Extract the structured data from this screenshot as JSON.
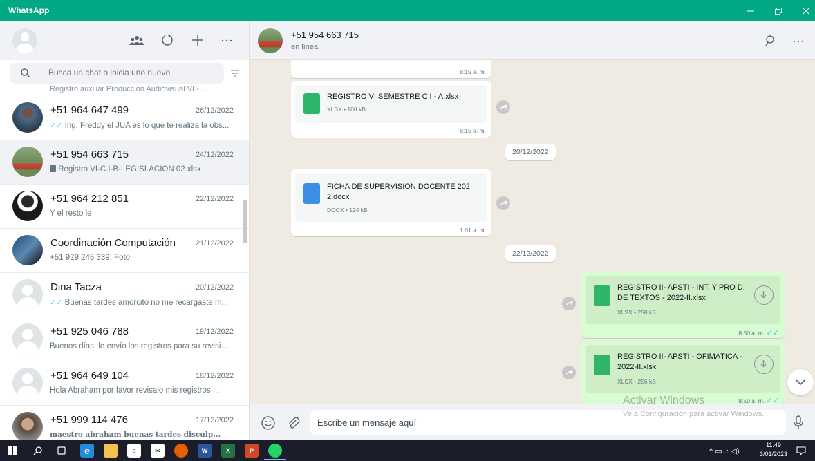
{
  "window": {
    "title": "WhatsApp"
  },
  "search": {
    "placeholder": "Busca un chat o inicia uno nuevo."
  },
  "chats": {
    "partial_top": "Registro auxiliar Producción Audiovisual VI - ...",
    "items": [
      {
        "name": "+51 964 647 499",
        "date": "26/12/2022",
        "preview": "Ing. Freddy el JUA es lo que te realiza la obs...",
        "ticks": "✓✓"
      },
      {
        "name": "+51 954 663 715",
        "date": "24/12/2022",
        "preview": "Registro VI-C.I-B-LEGISLACION 02.xlsx",
        "doc_icon": "document-icon"
      },
      {
        "name": "+51 964 212 851",
        "date": "22/12/2022",
        "preview": "Y el resto le"
      },
      {
        "name": "Coordinación Computación",
        "date": "21/12/2022",
        "preview": "+51 929 245 339:  Foto",
        "camera_icon": "camera-icon"
      },
      {
        "name": "Dina Tacza",
        "date": "20/12/2022",
        "preview": "Buenas tardes amorcito no me recargaste m...",
        "ticks": "✓✓"
      },
      {
        "name": "+51 925 046 788",
        "date": "19/12/2022",
        "preview": "Buenos días, le envío los registros para su revisi..."
      },
      {
        "name": "+51 964 649 104",
        "date": "18/12/2022",
        "preview": "Hola Abraham por favor revisalo mis registros ..."
      },
      {
        "name": "+51 999 114 476",
        "date": "17/12/2022",
        "preview": "maestro abraham buenas tardes disculp..."
      }
    ]
  },
  "conversation": {
    "contact_name": "+51 954 663 715",
    "status": "en línea",
    "first_time": "8:15 a. m.",
    "messages": [
      {
        "file": "REGISTRO VI SEMESTRE C I - A.xlsx",
        "meta": "XLSX • 108 kB",
        "time": "8:15 a. m."
      },
      {
        "file": "FICHA DE SUPERVISION DOCENTE 202 2.docx",
        "meta": "DOCX • 124 kB",
        "time": "1:01 a. m."
      },
      {
        "file": "REGISTRO II- APSTI - INT. Y PRO D. DE TEXTOS - 2022-II.xlsx",
        "meta": "XLSX • 258 kB",
        "time": "8:50 a. m."
      },
      {
        "file": "REGISTRO II- APSTI - OFIMÁTICA - 2022-II.xlsx",
        "meta": "XLSX • 256 kB",
        "time": "8:50 a. m."
      }
    ],
    "dates": [
      "20/12/2022",
      "22/12/2022"
    ]
  },
  "composer": {
    "placeholder": "Escribe un mensaje aquí"
  },
  "watermark": {
    "line1": "Activar Windows",
    "line2": "Ve a Configuración para activar Windows."
  },
  "taskbar": {
    "time": "11:49",
    "date": "3/01/2023"
  },
  "colors": {
    "brand": "#00a884",
    "outgoing": "#d9fdd3",
    "tick": "#53bdeb"
  }
}
